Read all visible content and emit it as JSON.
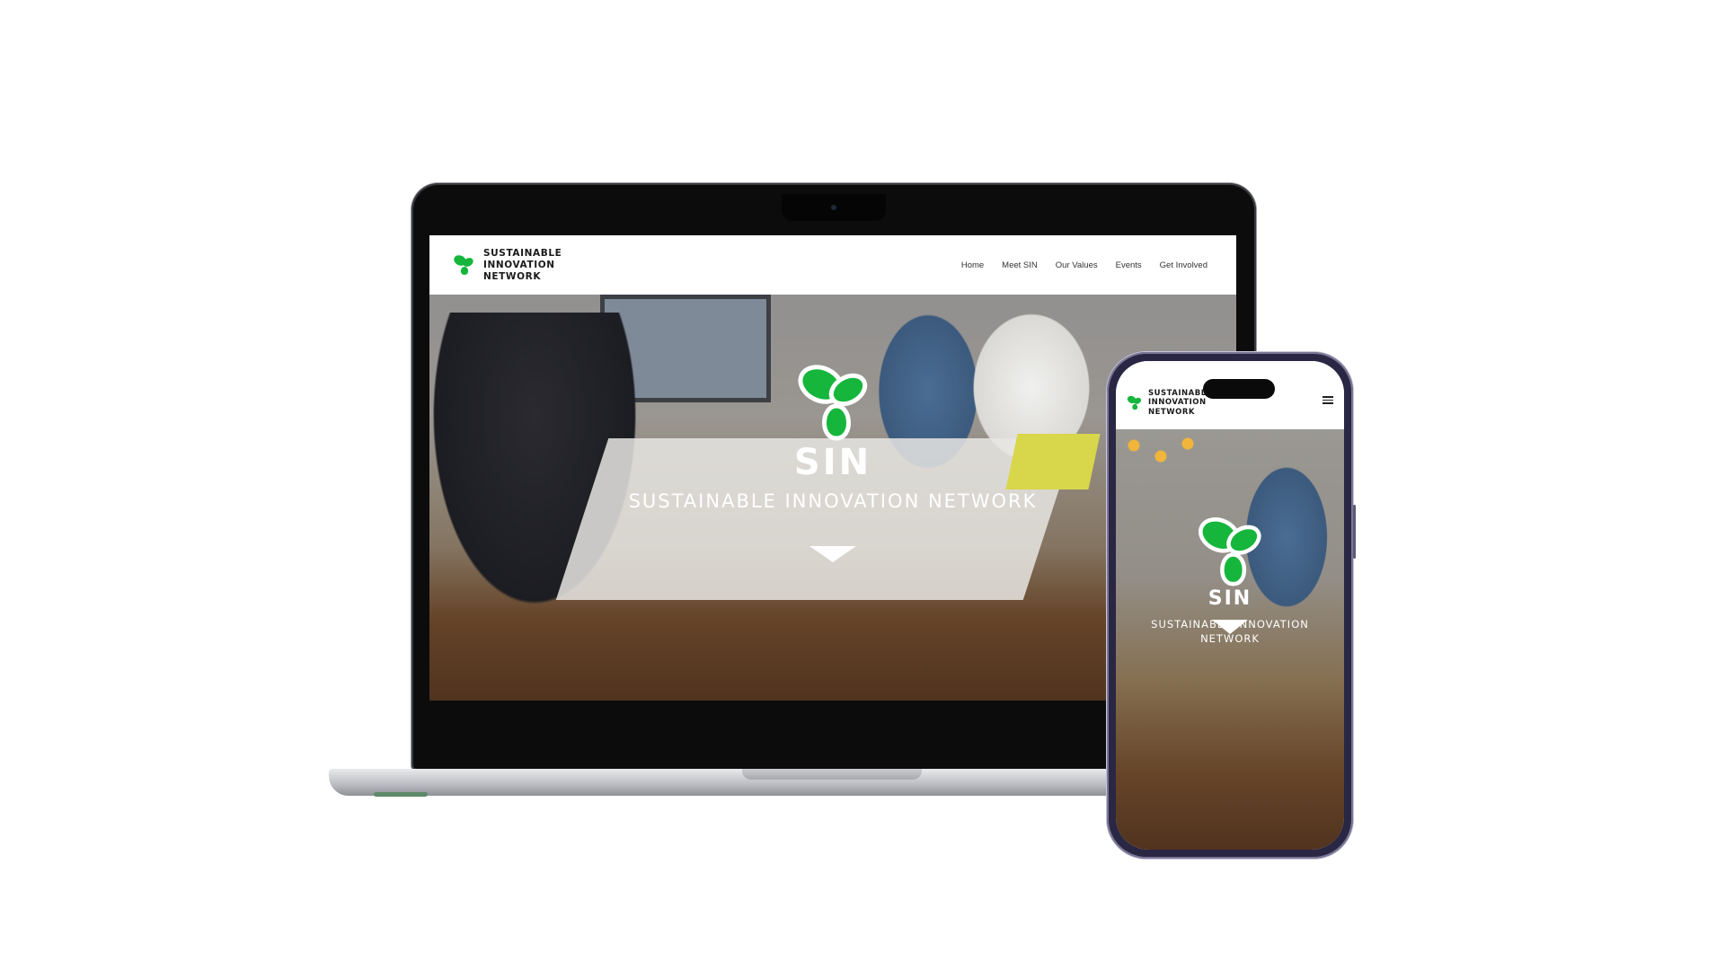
{
  "site": {
    "brand_lines": [
      "SUSTAINABLE",
      "INNOVATION",
      "NETWORK"
    ],
    "nav": [
      "Home",
      "Meet SIN",
      "Our Values",
      "Events",
      "Get Involved"
    ],
    "hero_title": "SIN",
    "hero_subtitle": "SUSTAINABLE INNOVATION NETWORK",
    "colors": {
      "brand_green": "#16b63c",
      "header_bg": "#ffffff",
      "hero_text": "#ffffff"
    }
  },
  "mobile": {
    "brand_lines": [
      "SUSTAINABLE",
      "INNOVATION",
      "NETWORK"
    ],
    "hero_title": "SIN",
    "hero_subtitle": "SUSTAINABLE INNOVATION NETWORK",
    "menu_icon": "hamburger-menu-icon"
  }
}
